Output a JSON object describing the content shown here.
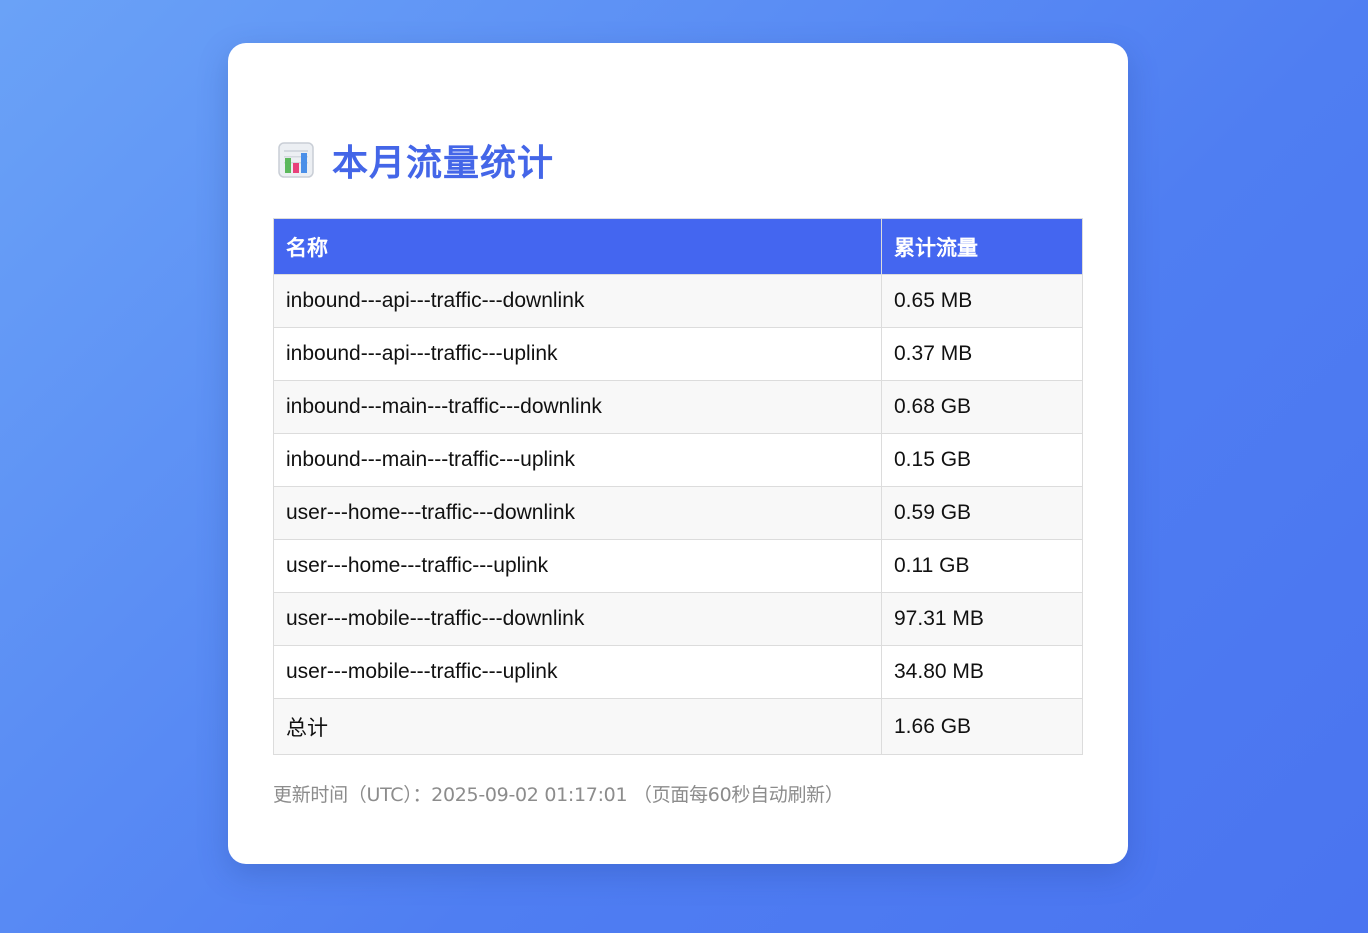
{
  "page": {
    "title": "本月流量统计",
    "icon": "bar-chart-icon"
  },
  "table": {
    "headers": [
      "名称",
      "累计流量"
    ],
    "rows": [
      {
        "name": "inbound---api---traffic---downlink",
        "value": "0.65 MB"
      },
      {
        "name": "inbound---api---traffic---uplink",
        "value": "0.37 MB"
      },
      {
        "name": "inbound---main---traffic---downlink",
        "value": "0.68 GB"
      },
      {
        "name": "inbound---main---traffic---uplink",
        "value": "0.15 GB"
      },
      {
        "name": "user---home---traffic---downlink",
        "value": "0.59 GB"
      },
      {
        "name": "user---home---traffic---uplink",
        "value": "0.11 GB"
      },
      {
        "name": "user---mobile---traffic---downlink",
        "value": "97.31 MB"
      },
      {
        "name": "user---mobile---traffic---uplink",
        "value": "34.80 MB"
      }
    ],
    "total": {
      "name": "总计",
      "value": "1.66 GB"
    }
  },
  "footer": {
    "text": "更新时间（UTC）：2025-09-02 01:17:01 （页面每60秒自动刷新）"
  },
  "colors": {
    "accent": "#4466f0",
    "title": "#4466e8",
    "background_start": "#6aa2f7",
    "background_end": "#4a74f0"
  }
}
